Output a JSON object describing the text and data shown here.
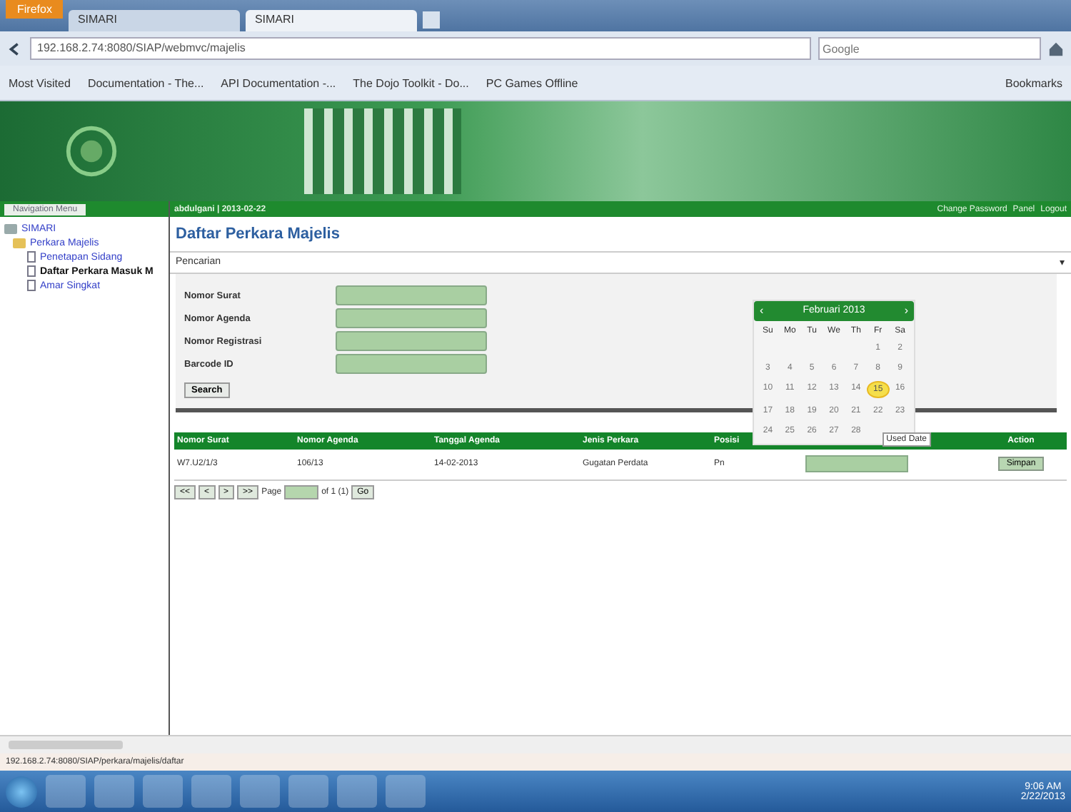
{
  "browser": {
    "tabs": [
      {
        "label": "SIMARI",
        "selected": false
      },
      {
        "label": "SIMARI",
        "selected": true
      }
    ],
    "app_button": "Firefox",
    "address": "192.168.2.74:8080/SIAP/webmvc/majelis",
    "search_placeholder": "Google",
    "bookmarks": [
      "Most Visited",
      "Documentation - The...",
      "API Documentation -...",
      "The Dojo Toolkit - Do...",
      "PC Games Offline"
    ],
    "bookmarks_menu": "Bookmarks"
  },
  "sidebar": {
    "tab": "Navigation Menu",
    "tree": [
      {
        "label": "SIMARI",
        "children": [
          {
            "label": "Perkara Majelis",
            "children": [
              {
                "label": "Penetapan Sidang",
                "selected": false
              },
              {
                "label": "Daftar Perkara Masuk M",
                "selected": true
              },
              {
                "label": "Amar Singkat",
                "selected": false
              }
            ]
          }
        ]
      }
    ]
  },
  "topbar": {
    "user": "abdulgani | 2013-02-22",
    "links": [
      "Change Password",
      "Panel",
      "Logout"
    ]
  },
  "page_title": "Daftar Perkara Majelis",
  "search_panel": {
    "title": "Pencarian",
    "toggle": "▾",
    "expanded": true,
    "fields": [
      {
        "label": "Nomor Surat"
      },
      {
        "label": "Nomor Agenda"
      },
      {
        "label": "Nomor Registrasi"
      },
      {
        "label": "Barcode ID"
      }
    ],
    "button": "Search"
  },
  "calendar": {
    "prev": "‹",
    "next": "›",
    "month": "Februari 2013",
    "weekdays": [
      "Su",
      "Mo",
      "Tu",
      "We",
      "Th",
      "Fr",
      "Sa"
    ],
    "weeks": [
      {
        "kind": "first",
        "days": [
          {
            "day": "1",
            "selected": false
          },
          {
            "day": "2",
            "selected": false
          }
        ]
      },
      {
        "kind": "full",
        "days": [
          {
            "day": "3",
            "selected": false
          },
          {
            "day": "4",
            "selected": false
          },
          {
            "day": "5",
            "selected": false
          },
          {
            "day": "6",
            "selected": false
          },
          {
            "day": "7",
            "selected": false
          },
          {
            "day": "8",
            "selected": false
          },
          {
            "day": "9",
            "selected": false
          }
        ]
      },
      {
        "kind": "full",
        "days": [
          {
            "day": "10",
            "selected": false
          },
          {
            "day": "11",
            "selected": false
          },
          {
            "day": "12",
            "selected": false
          },
          {
            "day": "13",
            "selected": false
          },
          {
            "day": "14",
            "selected": false
          },
          {
            "day": "15",
            "selected": true
          },
          {
            "day": "16",
            "selected": false
          }
        ]
      },
      {
        "kind": "full",
        "days": [
          {
            "day": "17",
            "selected": false
          },
          {
            "day": "18",
            "selected": false
          },
          {
            "day": "19",
            "selected": false
          },
          {
            "day": "20",
            "selected": false
          },
          {
            "day": "21",
            "selected": false
          },
          {
            "day": "22",
            "selected": false
          },
          {
            "day": "23",
            "selected": false
          }
        ]
      },
      {
        "kind": "last",
        "days": [
          {
            "day": "24",
            "selected": false
          },
          {
            "day": "25",
            "selected": false
          },
          {
            "day": "26",
            "selected": false
          },
          {
            "day": "27",
            "selected": false
          },
          {
            "day": "28",
            "selected": false
          }
        ]
      }
    ],
    "tooltip": "Used Date"
  },
  "table": {
    "columns": [
      "Nomor Surat",
      "Nomor Agenda",
      "Tanggal Agenda",
      "Jenis Perkara",
      "Posisi",
      "Action"
    ],
    "rows": [
      {
        "cells": [
          "W7.U2/1/3",
          "106/13",
          "14-02-2013",
          "Gugatan Perdata",
          "Pn"
        ],
        "button": "Simpan"
      }
    ]
  },
  "pager": {
    "buttons": [
      "<<",
      "<",
      ">",
      ">>"
    ],
    "page_label": "Page",
    "of": "of 1 (1)",
    "go": "Go"
  },
  "status_url": "192.168.2.74:8080/SIAP/perkara/majelis/daftar",
  "taskbar": {
    "time": "9:06 AM",
    "date": "2/22/2013"
  }
}
